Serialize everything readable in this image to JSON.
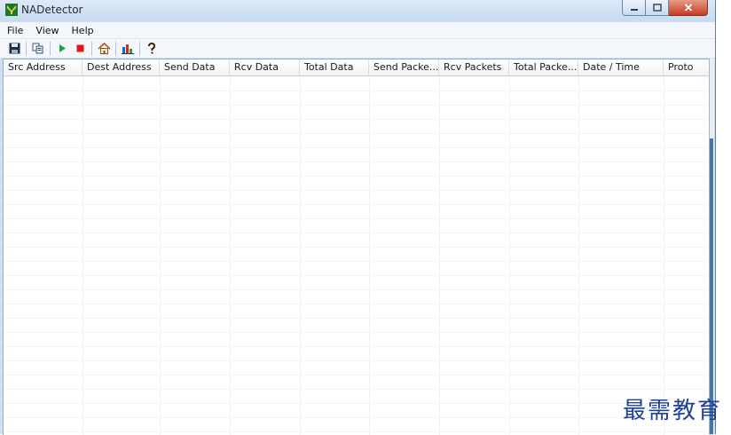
{
  "window": {
    "title": "NADetector",
    "colors": {
      "titlebar": "#c7daef",
      "close": "#c43c23",
      "grid_line": "#eef1f5"
    }
  },
  "menu": {
    "items": [
      {
        "label": "File"
      },
      {
        "label": "View"
      },
      {
        "label": "Help"
      }
    ]
  },
  "toolbar": {
    "buttons": [
      {
        "icon": "save-icon"
      },
      {
        "icon": "copy-icon"
      },
      {
        "icon": "play-icon"
      },
      {
        "icon": "stop-icon"
      },
      {
        "icon": "home-icon"
      },
      {
        "icon": "chart-icon"
      },
      {
        "icon": "help-icon"
      }
    ]
  },
  "table": {
    "columns": [
      "Src Address",
      "Dest Address",
      "Send Data",
      "Rcv Data",
      "Total Data",
      "Send Packe...",
      "Rcv Packets",
      "Total Packe...",
      "Date / Time",
      "Proto"
    ],
    "rows": []
  },
  "watermark": "最需教育"
}
